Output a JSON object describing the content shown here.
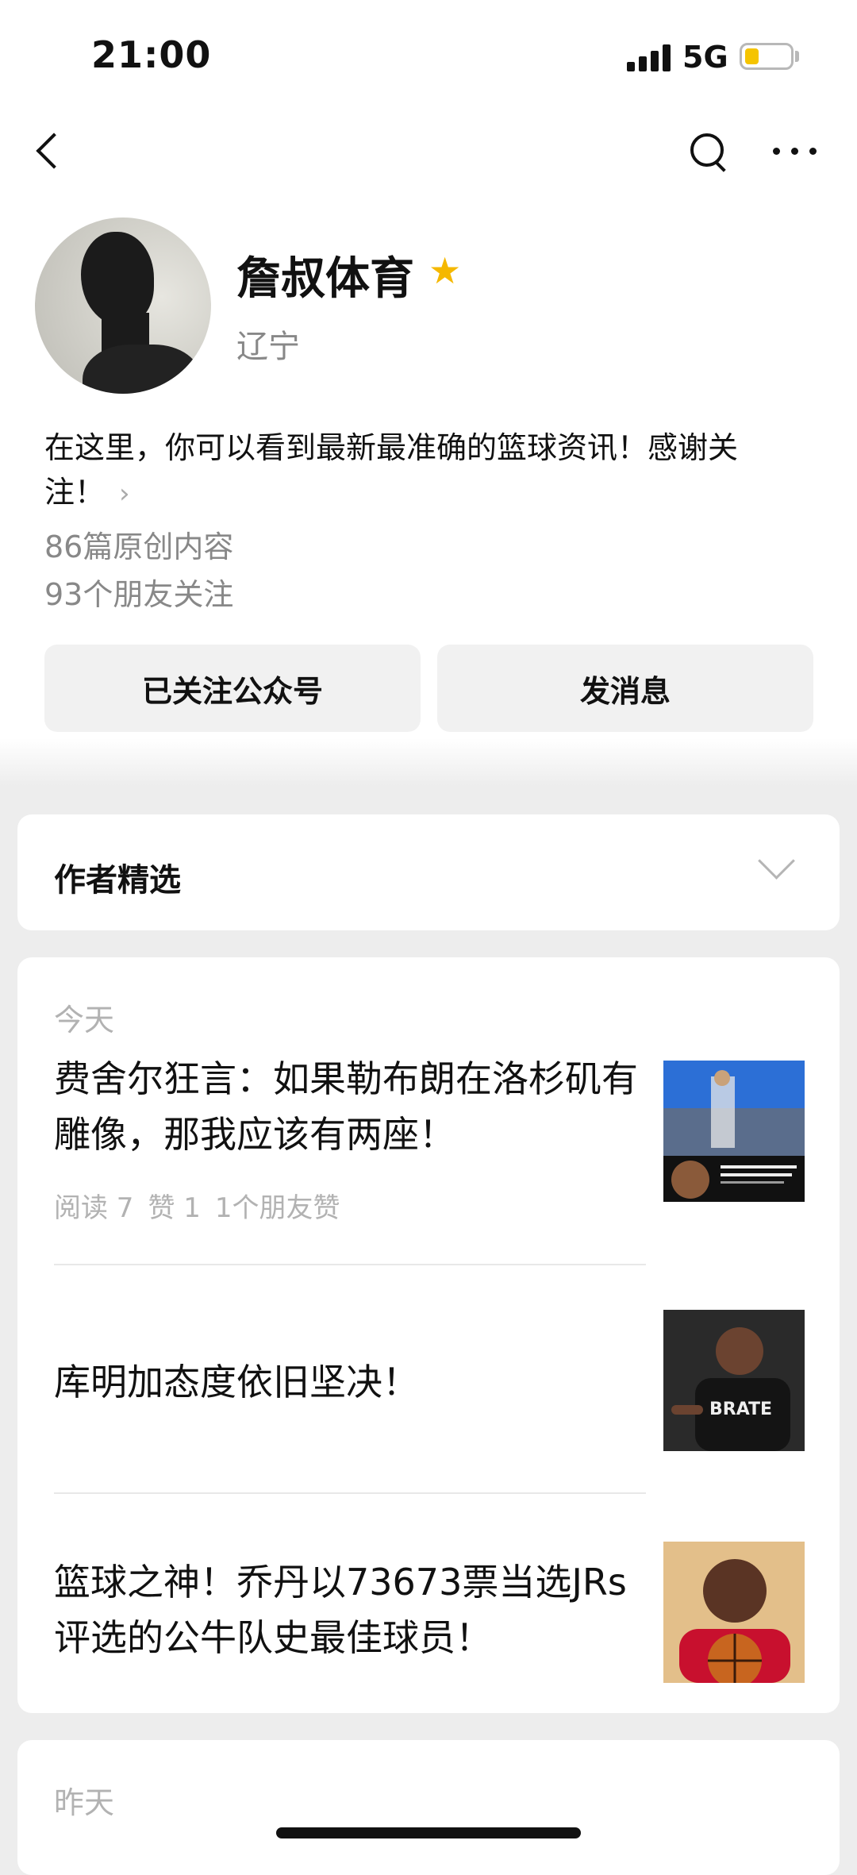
{
  "status_bar": {
    "time": "21:00",
    "network": "5G",
    "battery_level": 0.3,
    "signal_icon": "cellular-signal-icon",
    "battery_icon": "battery-icon",
    "battery_color": "#f5c400"
  },
  "nav": {
    "back_icon": "chevron-left-icon",
    "search_icon": "search-icon",
    "more_icon": "more-dots-icon"
  },
  "profile": {
    "name": "詹叔体育",
    "star_icon": "star-icon",
    "star_color": "#f5b800",
    "region": "辽宁",
    "bio": "在这里，你可以看到最新最准确的篮球资讯！感谢关注！",
    "original_count": "86篇原创内容",
    "friends_following": "93个朋友关注"
  },
  "actions": {
    "follow_label": "已关注公众号",
    "message_label": "发消息"
  },
  "author_picks": {
    "title": "作者精选",
    "expand_icon": "chevron-down-icon"
  },
  "today": {
    "date_label": "今天",
    "articles": [
      {
        "title": "费舍尔狂言：如果勒布朗在洛杉矶有雕像，那我应该有两座！",
        "reads": "阅读 7",
        "likes": "赞 1",
        "friend_likes": "1个朋友赞",
        "thumb_icon": "article-thumbnail-image"
      },
      {
        "title": "库明加态度依旧坚决！",
        "thumb_icon": "article-thumbnail-image"
      },
      {
        "title": "篮球之神！乔丹以73673票当选JRs评选的公牛队史最佳球员！",
        "thumb_icon": "article-thumbnail-image"
      }
    ]
  },
  "yesterday": {
    "date_label": "昨天"
  }
}
